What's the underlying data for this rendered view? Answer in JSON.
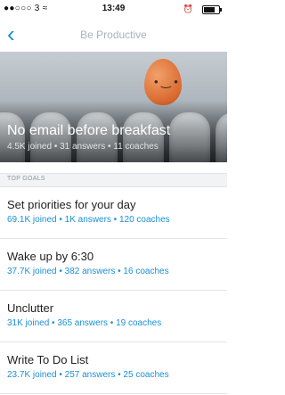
{
  "status_bar": {
    "signal": "●●○○○ 3 ≈",
    "time": "13:49",
    "alarm": "⏰",
    "battery_fill": 0.75
  },
  "nav": {
    "back_icon": "‹",
    "title": "Be Productive"
  },
  "hero": {
    "title": "No email before breakfast",
    "meta": "4.5K joined • 31 answers • 11 coaches"
  },
  "section": {
    "label": "TOP GOALS"
  },
  "goals": [
    {
      "title": "Set priorities for your day",
      "meta": "69.1K joined • 1K answers • 120 coaches"
    },
    {
      "title": "Wake up by 6:30",
      "meta": "37.7K joined • 382 answers • 16 coaches"
    },
    {
      "title": "Unclutter",
      "meta": "31K joined • 365 answers • 19 coaches"
    },
    {
      "title": "Write To Do List",
      "meta": "23.7K joined • 257 answers • 25 coaches"
    }
  ]
}
